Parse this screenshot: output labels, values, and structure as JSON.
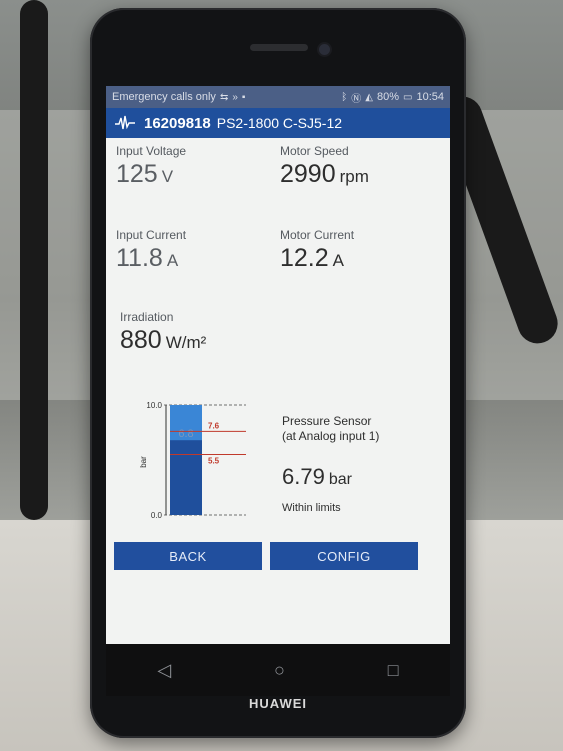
{
  "status_bar": {
    "carrier": "Emergency calls only",
    "battery": "80%",
    "time": "10:54"
  },
  "app_bar": {
    "serial": "16209818",
    "model": "PS2-1800 C-SJ5-12"
  },
  "metrics": {
    "input_voltage": {
      "label": "Input Voltage",
      "value": "125",
      "unit": "V"
    },
    "motor_speed": {
      "label": "Motor Speed",
      "value": "2990",
      "unit": "rpm"
    },
    "input_current": {
      "label": "Input Current",
      "value": "11.8",
      "unit": "A"
    },
    "motor_current": {
      "label": "Motor Current",
      "value": "12.2",
      "unit": "A"
    },
    "irradiation": {
      "label": "Irradiation",
      "value": "880",
      "unit": "W/m²"
    }
  },
  "pressure": {
    "title": "Pressure Sensor",
    "subtitle": "(at Analog input 1)",
    "value": "6.79",
    "unit": "bar",
    "status": "Within limits"
  },
  "chart_data": {
    "type": "bar",
    "ylabel": "bar",
    "ylim": [
      0.0,
      10.0
    ],
    "tick_labels": [
      "10.0",
      "0.0"
    ],
    "values": [
      6.8
    ],
    "bar_label": "6.8",
    "thresholds": [
      {
        "label": "7.6",
        "value": 7.6
      },
      {
        "label": "5.5",
        "value": 5.5
      }
    ],
    "colors": {
      "bar": "#1f4f9c",
      "threshold": "#c0392b"
    }
  },
  "buttons": {
    "back": "BACK",
    "config": "CONFIG"
  },
  "device": {
    "brand": "HUAWEI"
  }
}
